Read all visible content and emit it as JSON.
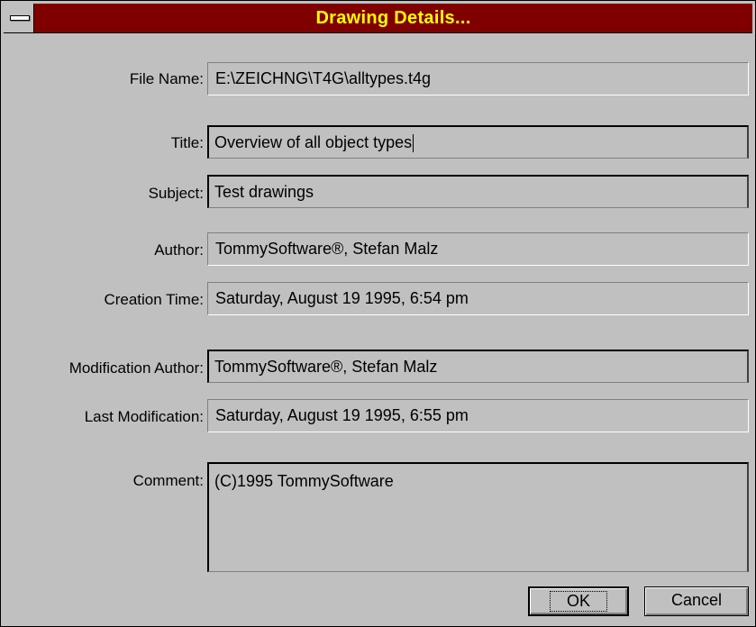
{
  "window": {
    "title": "Drawing Details..."
  },
  "fields": {
    "file_name": {
      "label": "File Name:",
      "value": "E:\\ZEICHNG\\T4G\\alltypes.t4g"
    },
    "title": {
      "label": "Title:",
      "value": "Overview of all object types"
    },
    "subject": {
      "label": "Subject:",
      "value": "Test drawings"
    },
    "author": {
      "label": "Author:",
      "value": "TommySoftware®, Stefan Malz"
    },
    "creation_time": {
      "label": "Creation Time:",
      "value": "Saturday, August 19 1995, 6:54 pm"
    },
    "modification_author": {
      "label": "Modification Author:",
      "value": "TommySoftware®, Stefan Malz"
    },
    "last_modification": {
      "label": "Last Modification:",
      "value": "Saturday, August 19 1995, 6:55 pm"
    },
    "comment": {
      "label": "Comment:",
      "value": "(C)1995 TommySoftware"
    }
  },
  "buttons": {
    "ok": "OK",
    "cancel": "Cancel"
  },
  "icons": {
    "system_menu": "system-menu-icon"
  }
}
